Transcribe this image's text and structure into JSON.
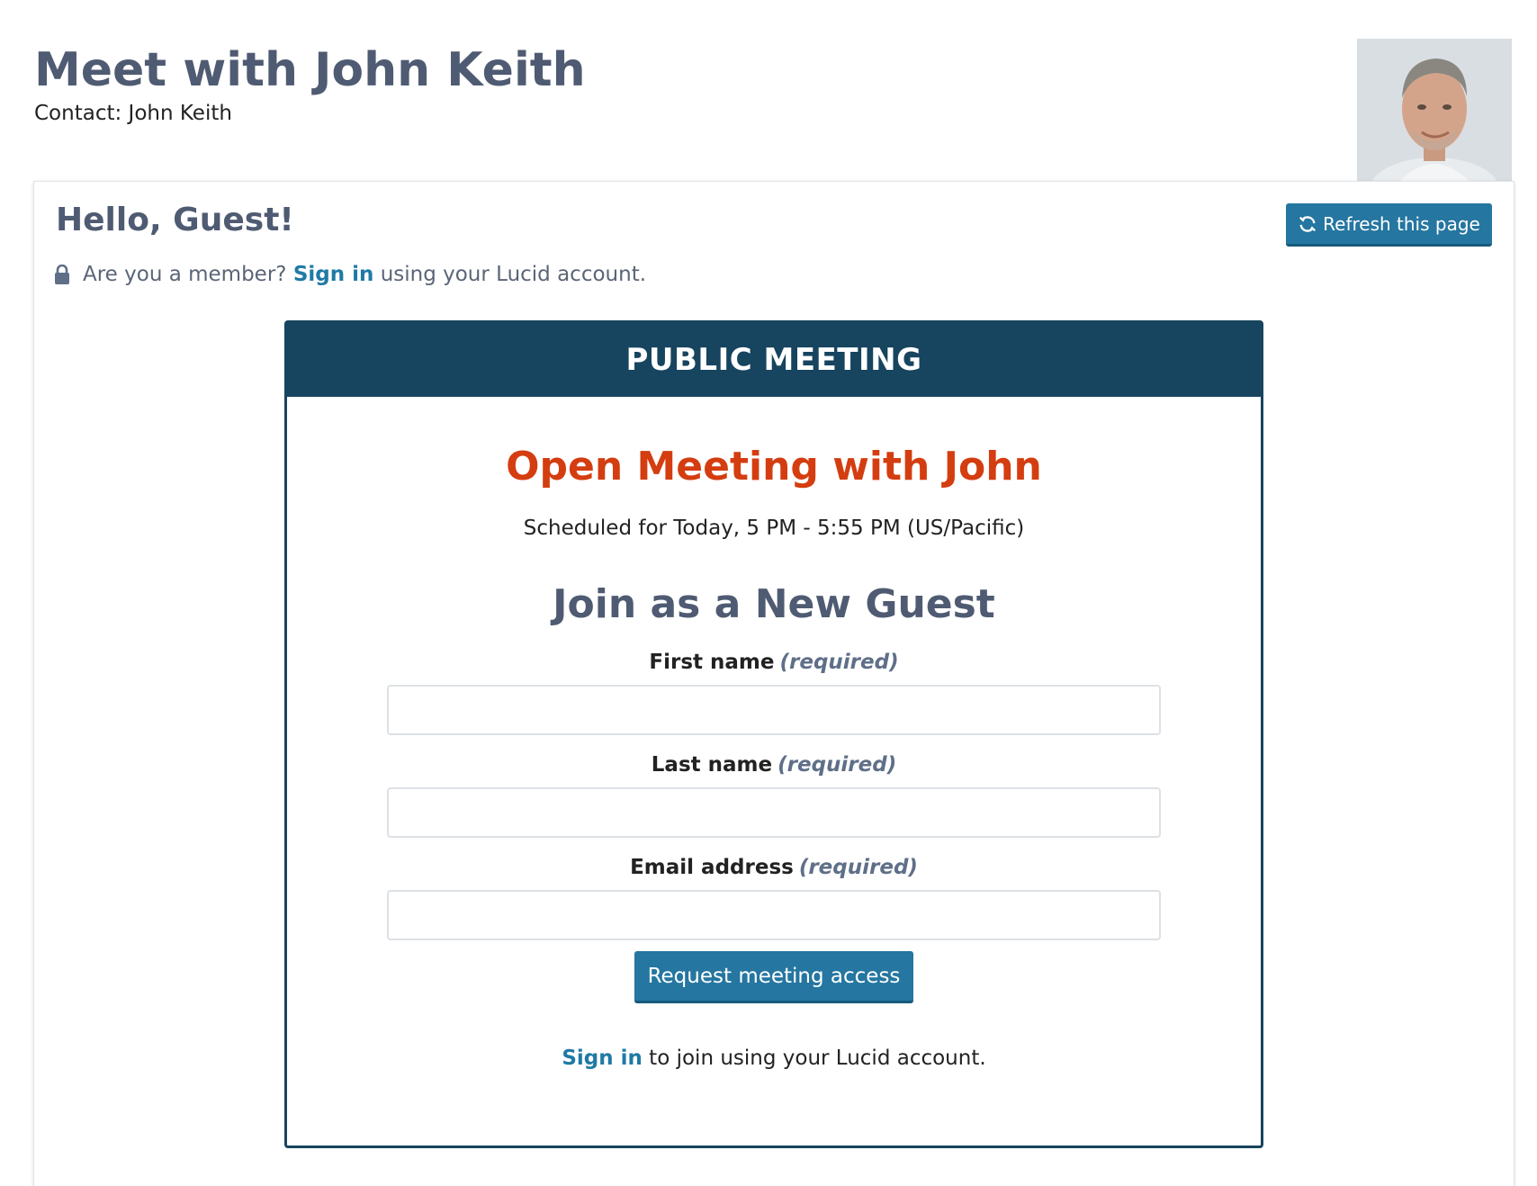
{
  "header": {
    "title": "Meet with John Keith",
    "contact": "Contact: John Keith"
  },
  "card": {
    "greeting": "Hello, Guest!",
    "member_prompt": "Are you a member?",
    "sign_in_link": "Sign in",
    "member_suffix": "using your Lucid account.",
    "refresh_label": "Refresh this page"
  },
  "meeting": {
    "banner": "PUBLIC MEETING",
    "title": "Open Meeting with John",
    "schedule": "Scheduled for Today, 5 PM - 5:55 PM (US/Pacific)",
    "join_heading": "Join as a New Guest",
    "fields": {
      "first_name": {
        "label": "First name",
        "note": "(required)",
        "value": ""
      },
      "last_name": {
        "label": "Last name",
        "note": "(required)",
        "value": ""
      },
      "email": {
        "label": "Email address",
        "note": "(required)",
        "value": ""
      }
    },
    "submit_label": "Request meeting access",
    "footer_link": "Sign in",
    "footer_text": " to join using your Lucid account."
  },
  "colors": {
    "brand_dark": "#17445f",
    "button": "#2576a0",
    "link": "#1f7aa5",
    "meeting_title": "#d43d10",
    "heading": "#4f5b72"
  },
  "icons": {
    "lock": "lock-icon",
    "refresh": "refresh-icon"
  }
}
